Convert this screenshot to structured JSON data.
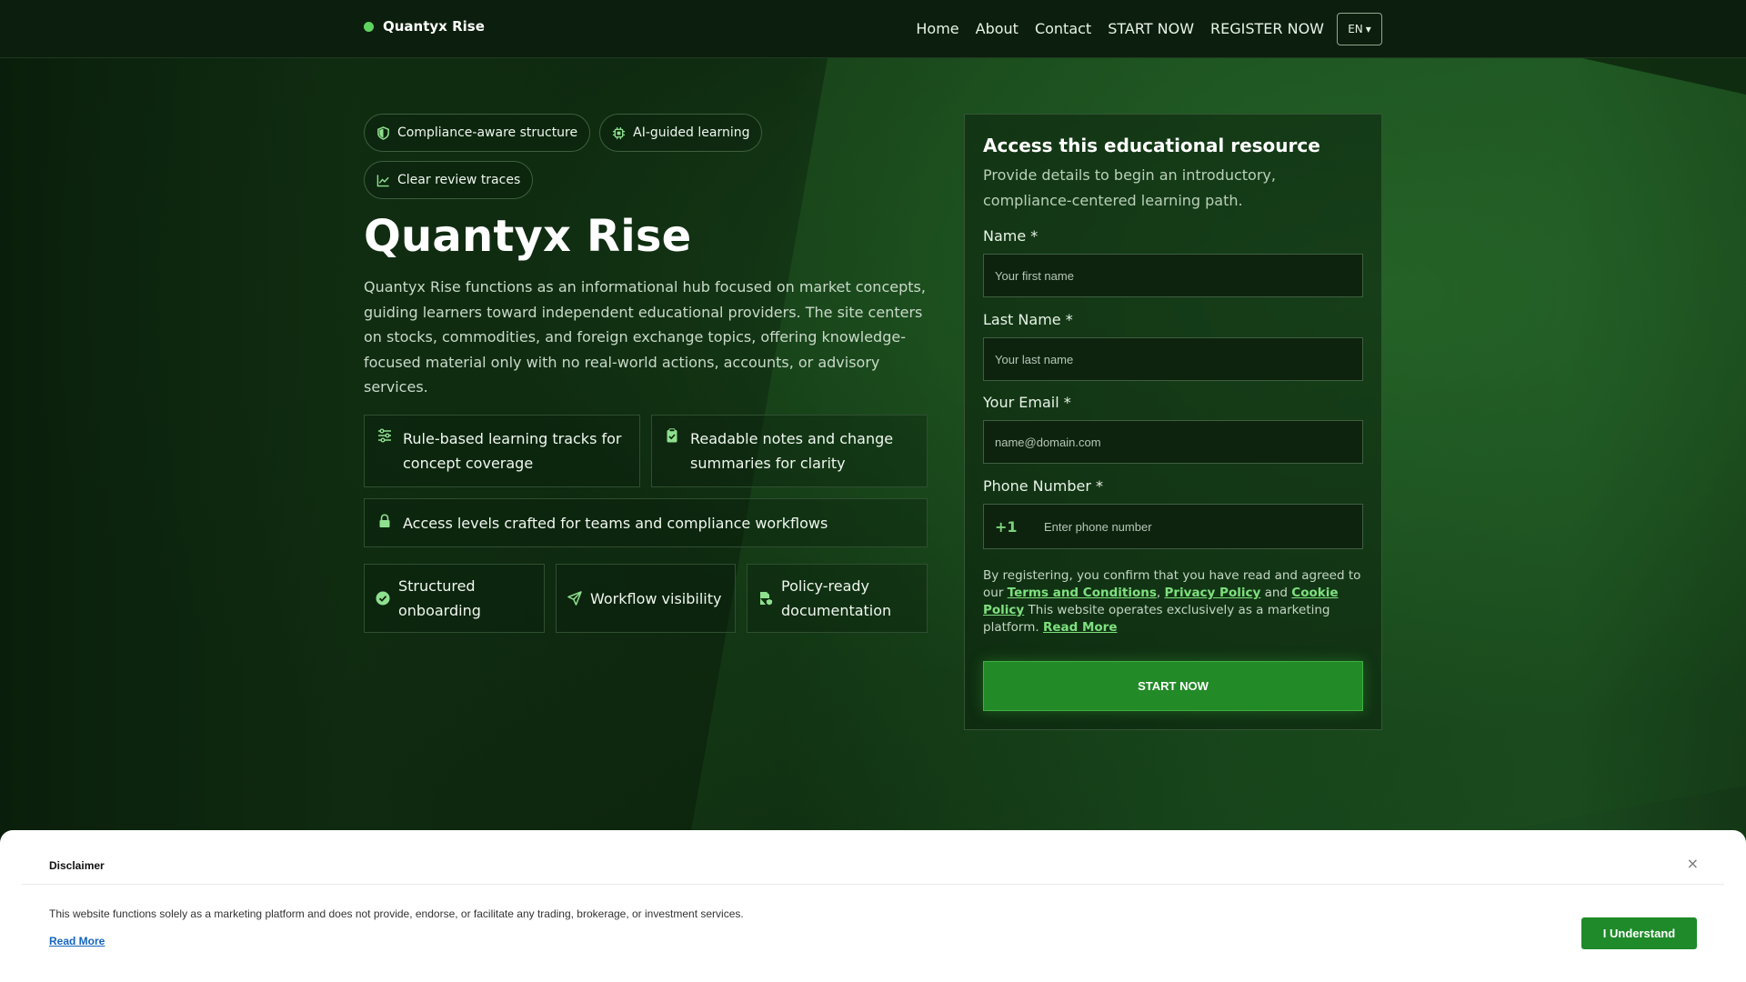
{
  "header": {
    "brand": "Quantyx Rise",
    "nav": [
      "Home",
      "About",
      "Contact",
      "START NOW",
      "REGISTER NOW"
    ],
    "lang": "EN"
  },
  "hero": {
    "chips": [
      "Compliance-aware structure",
      "AI-guided learning",
      "Clear review traces"
    ],
    "title": "Quantyx Rise",
    "description": "Quantyx Rise functions as an informational hub focused on market concepts, guiding learners toward independent educational providers. The site centers on stocks, commodities, and foreign exchange topics, offering knowledge-focused material only with no real-world actions, accounts, or advisory services.",
    "features": [
      "Rule-based learning tracks for concept coverage",
      "Readable notes and change summaries for clarity",
      "Access levels crafted for teams and compliance workflows"
    ],
    "mini_features": [
      "Structured onboarding",
      "Workflow visibility",
      "Policy-ready documentation"
    ]
  },
  "form": {
    "title": "Access this educational resource",
    "subtitle": "Provide details to begin an introductory, compliance-centered learning path.",
    "fields": {
      "first_name": {
        "label": "Name *",
        "placeholder": "Your first name"
      },
      "last_name": {
        "label": "Last Name *",
        "placeholder": "Your last name"
      },
      "email": {
        "label": "Your Email *",
        "placeholder": "name@domain.com"
      },
      "phone": {
        "label": "Phone Number *",
        "code": "+1",
        "placeholder": "Enter phone number"
      }
    },
    "consent": {
      "prefix": "By registering, you confirm that you have read and agreed to our",
      "terms": "Terms and Conditions",
      "privacy": "Privacy Policy",
      "and": "and",
      "cookie": "Cookie Policy",
      "suffix": "This website operates exclusively as a marketing platform.",
      "read_more": "Read More"
    },
    "submit": "START NOW"
  },
  "disclaimer": {
    "title": "Disclaimer",
    "close": "×",
    "text": "This website functions solely as a marketing platform and does not provide, endorse, or facilitate any trading, brokerage, or investment services.",
    "read_more": "Read More",
    "button": "I Understand"
  },
  "colors": {
    "accent": "#5fd35f",
    "primary_button": "#228a27",
    "disclaimer_button": "#1e8a2a",
    "link_blue": "#1565c0"
  }
}
